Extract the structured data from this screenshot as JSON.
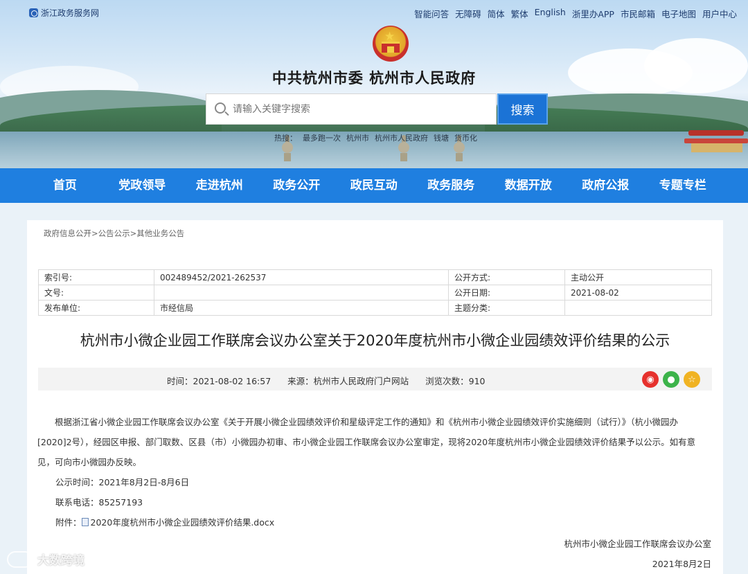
{
  "header": {
    "site_link": "浙江政务服务网",
    "top_nav": [
      "智能问答",
      "无障碍",
      "简体",
      "繁体",
      "English",
      "浙里办APP",
      "市民邮箱",
      "电子地图",
      "用户中心"
    ],
    "site_title": "中共杭州市委  杭州市人民政府",
    "search_placeholder": "请输入关键字搜索",
    "search_button": "搜索",
    "hot_search": [
      "热搜：",
      "最多跑一次",
      "杭州市",
      "杭州市人民政府",
      "钱塘",
      "货币化"
    ]
  },
  "main_nav": [
    "首页",
    "党政领导",
    "走进杭州",
    "政务公开",
    "政民互动",
    "政务服务",
    "数据开放",
    "政府公报",
    "专题专栏"
  ],
  "breadcrumb": "政府信息公开>公告公示>其他业务公告",
  "meta": {
    "rows": [
      {
        "k1": "索引号:",
        "v1": "002489452/2021-262537",
        "k2": "公开方式:",
        "v2": "主动公开"
      },
      {
        "k1": "文号:",
        "v1": "",
        "k2": "公开日期:",
        "v2": "2021-08-02"
      },
      {
        "k1": "发布单位:",
        "v1": "市经信局",
        "k2": "主题分类:",
        "v2": ""
      }
    ]
  },
  "article": {
    "title": "杭州市小微企业园工作联席会议办公室关于2020年度杭州市小微企业园绩效评价结果的公示",
    "time": "时间：2021-08-02 16:57",
    "source": "来源：杭州市人民政府门户网站",
    "views": "浏览次数：910",
    "paragraph": "根据浙江省小微企业园工作联席会议办公室《关于开展小微企业园绩效评价和星级评定工作的通知》和《杭州市小微企业园绩效评价实施细则（试行）》（杭小微园办[2020]2号），经园区申报、部门取数、区县（市）小微园办初审、市小微企业园工作联席会议办公室审定，现将2020年度杭州市小微企业园绩效评价结果予以公示。如有意见，可向市小微园办反映。",
    "public_time": "公示时间：2021年8月2日-8月6日",
    "phone": "联系电话：85257193",
    "attachment_label": "附件：",
    "attachment_file": "2020年度杭州市小微企业园绩效评价结果.docx",
    "signature_org": "杭州市小微企业园工作联席会议办公室",
    "signature_date": "2021年8月2日"
  },
  "share_icons": [
    "weibo-icon",
    "wechat-icon",
    "favorite-icon"
  ],
  "watermark": "大数跨境",
  "colors": {
    "nav_blue": "#1f7fe0",
    "search_blue": "#1b73d6",
    "weibo": "#e6312d",
    "wechat": "#3cb34a",
    "favorite": "#f0b323"
  }
}
